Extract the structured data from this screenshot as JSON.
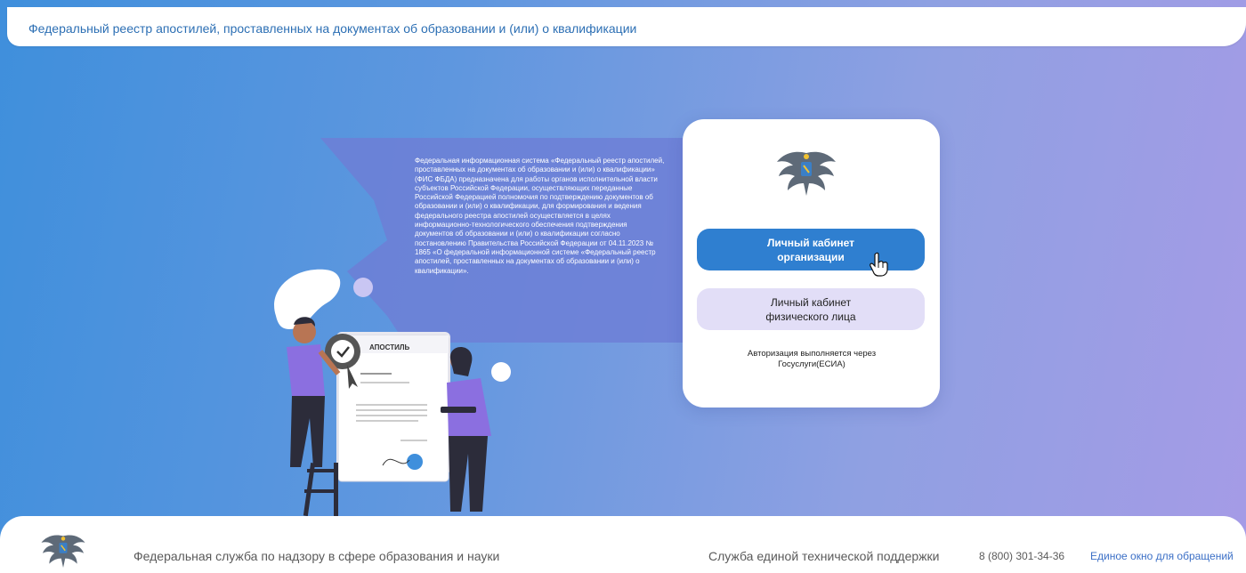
{
  "header": {
    "title": "Федеральный реестр апостилей, проставленных на документах об образовании и (или) о квалификации"
  },
  "intro": {
    "description": "Федеральная информационная система «Федеральный реестр апостилей, проставленных на документах об образовании и (или) о квалификации» (ФИС ФБДА) предназначена для работы органов исполнительной власти субъектов Российской Федерации, осуществляющих переданные Российской Федерацией полномочия по подтверждению документов об образовании и (или) о квалификации, для формирования и ведения федерального реестра апостилей осуществляется в целях информационно-технологического обеспечения подтверждения документов об образовании и (или) о квалификации согласно постановлению Правительства Российской Федерации от 04.11.2023 № 1865 «О федеральной информационной системе «Федеральный реестр апостилей, проставленных на документах об образовании и (или) о квалификации»."
  },
  "illustration": {
    "document_label": "АПОСТИЛЬ"
  },
  "login_card": {
    "org_button": "Личный кабинет организации",
    "person_button": "Личный кабинет физического лица",
    "auth_note": "Авторизация выполняется через Госуслуги(ЕСИА)"
  },
  "footer": {
    "org_name": "Федеральная служба по надзору в сфере образования и науки",
    "support_label": "Служба единой технической поддержки",
    "phone": "8 (800) 301-34-36",
    "appeal_link": "Единое окно для обращений"
  },
  "colors": {
    "primary": "#2f7fd0",
    "secondary_button": "#e2def7",
    "link": "#3b6fc6"
  }
}
